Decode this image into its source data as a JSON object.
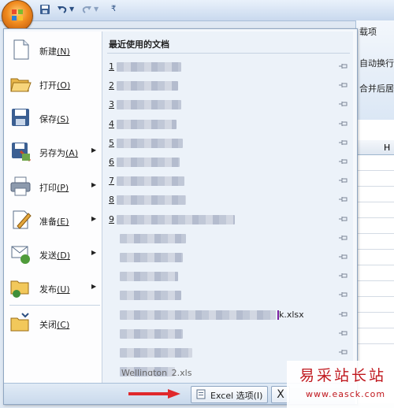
{
  "ribbon": {
    "tab_partial": "载项",
    "wrap_text": "自动换行",
    "merge_center": "合并后居",
    "column_h": "H"
  },
  "office_menu": {
    "items": [
      {
        "label": "新建",
        "key": "(N)"
      },
      {
        "label": "打开",
        "key": "(O)"
      },
      {
        "label": "保存",
        "key": "(S)"
      },
      {
        "label": "另存为",
        "key": "(A)"
      },
      {
        "label": "打印",
        "key": "(P)"
      },
      {
        "label": "准备",
        "key": "(E)"
      },
      {
        "label": "发送",
        "key": "(D)"
      },
      {
        "label": "发布",
        "key": "(U)"
      },
      {
        "label": "关闭",
        "key": "(C)"
      }
    ],
    "recent_title": "最近使用的文档",
    "recent": [
      {
        "num": "1"
      },
      {
        "num": "2"
      },
      {
        "num": "3"
      },
      {
        "num": "4"
      },
      {
        "num": "5"
      },
      {
        "num": "6"
      },
      {
        "num": "7"
      },
      {
        "num": "8"
      },
      {
        "num": "9"
      },
      {
        "num": ""
      },
      {
        "num": ""
      },
      {
        "num": ""
      },
      {
        "num": ""
      },
      {
        "num": "",
        "suffix": "k.xlsx"
      },
      {
        "num": ""
      },
      {
        "num": ""
      },
      {
        "num": ""
      }
    ],
    "last_partial": "Wellington_2.xls",
    "options_label": "Excel 选项(I)",
    "exit_label": "X"
  },
  "watermark": {
    "line1": "易采站长站",
    "line2": "www.easck.com"
  },
  "colors": {
    "accent_orange": "#f08a1e",
    "arrow_red": "#e0282b",
    "watermark_red": "#c0181e"
  }
}
